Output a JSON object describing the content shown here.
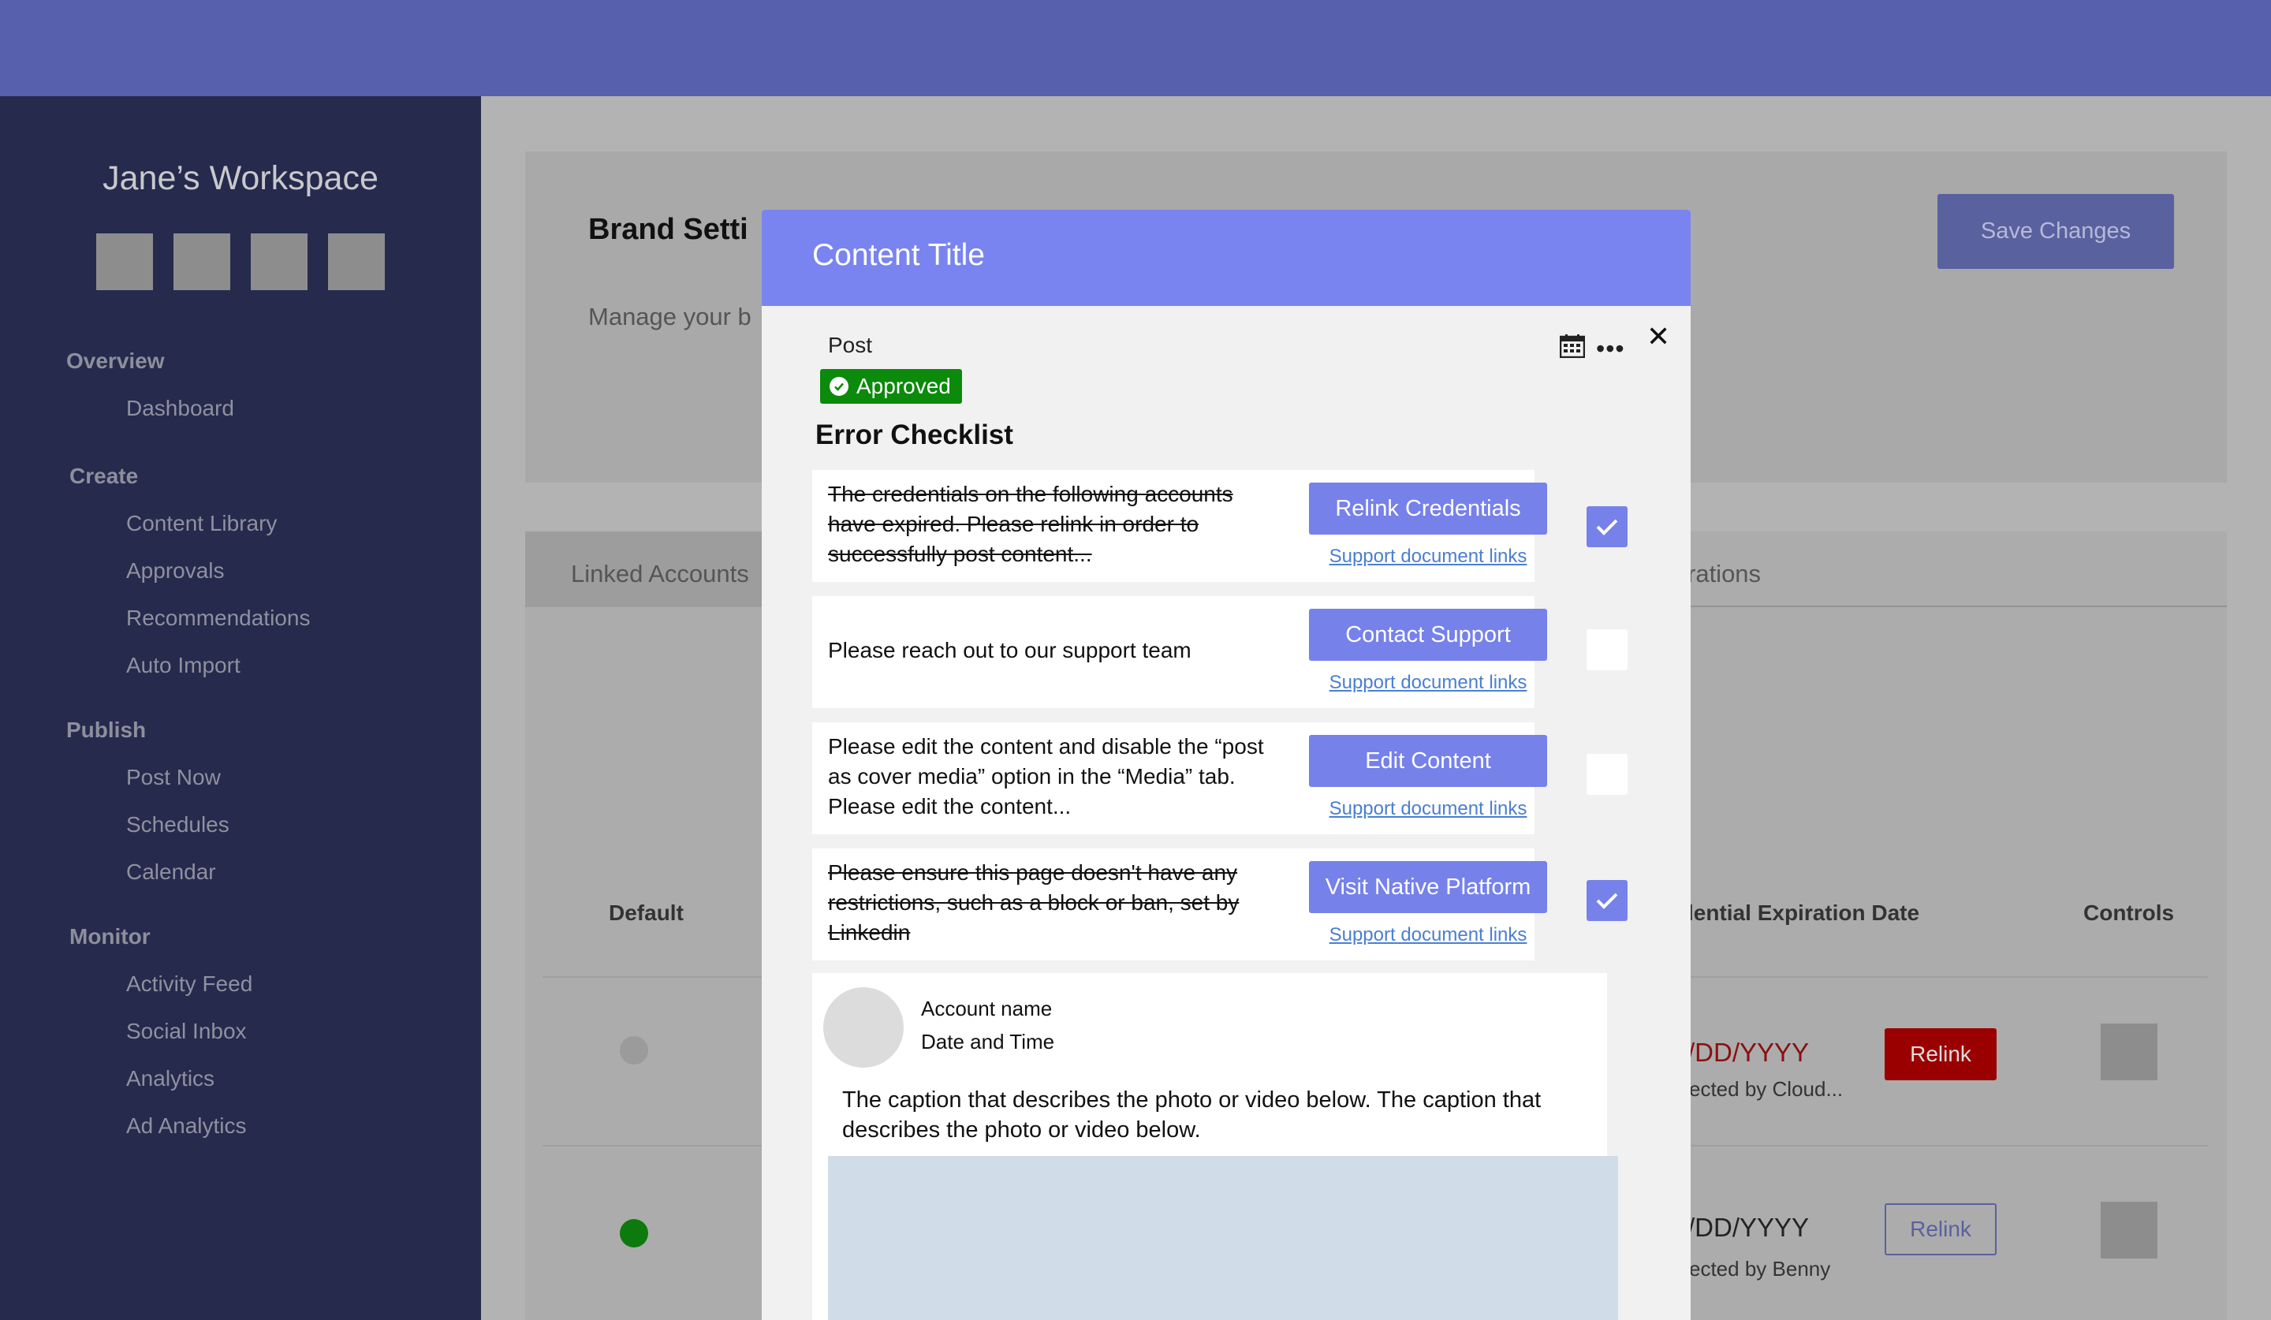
{
  "sidebar": {
    "workspace_title": "Jane’s Workspace",
    "sections": [
      {
        "heading": "Overview",
        "items": [
          "Dashboard"
        ]
      },
      {
        "heading": "Create",
        "items": [
          "Content Library",
          "Approvals",
          "Recommendations",
          "Auto Import"
        ]
      },
      {
        "heading": "Publish",
        "items": [
          "Post Now",
          "Schedules",
          "Calendar"
        ]
      },
      {
        "heading": "Monitor",
        "items": [
          "Activity Feed",
          "Social Inbox",
          "Analytics",
          "Ad Analytics"
        ]
      }
    ]
  },
  "brand": {
    "title": "Brand Setti",
    "subtitle": "Manage your b",
    "save_label": "Save Changes"
  },
  "tabs": {
    "linked": "Linked Accounts",
    "right": "rations"
  },
  "table": {
    "headers": {
      "default": "Default",
      "expiration": "lential Expiration Date",
      "controls": "Controls"
    },
    "rows": [
      {
        "date": "/DD/YYYY",
        "note": "ected by Cloud...",
        "relink": "Relink",
        "default_color": "#9b9b9b"
      },
      {
        "date": "/DD/YYYY",
        "note": "ected by Benny",
        "relink": "Relink",
        "default_color": "#0c7a0c"
      }
    ]
  },
  "modal": {
    "title": "Content Title",
    "post_label": "Post",
    "status": "Approved",
    "checklist_title": "Error Checklist",
    "errors": [
      {
        "text": "The credentials on the following accounts have expired. Please relink in order to successfully post content...",
        "button": "Relink Credentials",
        "link": "Support document links",
        "checked": true
      },
      {
        "text": "Please reach out to our support team",
        "button": "Contact Support",
        "link": "Support document links",
        "checked": false
      },
      {
        "text": "Please edit the content and disable the “post as cover media” option in the “Media” tab. Please edit the content...",
        "button": "Edit Content",
        "link": "Support document links",
        "checked": false
      },
      {
        "text": "Please ensure this page doesn't have any restrictions, such as a block or ban, set by Linkedin",
        "button": "Visit Native Platform",
        "link": "Support document links",
        "checked": true
      }
    ],
    "preview": {
      "account_name": "Account name",
      "date_time": "Date and Time",
      "caption": "The caption that describes the photo or video below. The caption that describes the photo or video below."
    }
  },
  "colors": {
    "topbar": "#5760ad",
    "sidebar": "#262a4d",
    "modal_header": "#7984f0",
    "accent": "#7681ea",
    "approved": "#0b8a0b",
    "danger": "#9b0000"
  }
}
